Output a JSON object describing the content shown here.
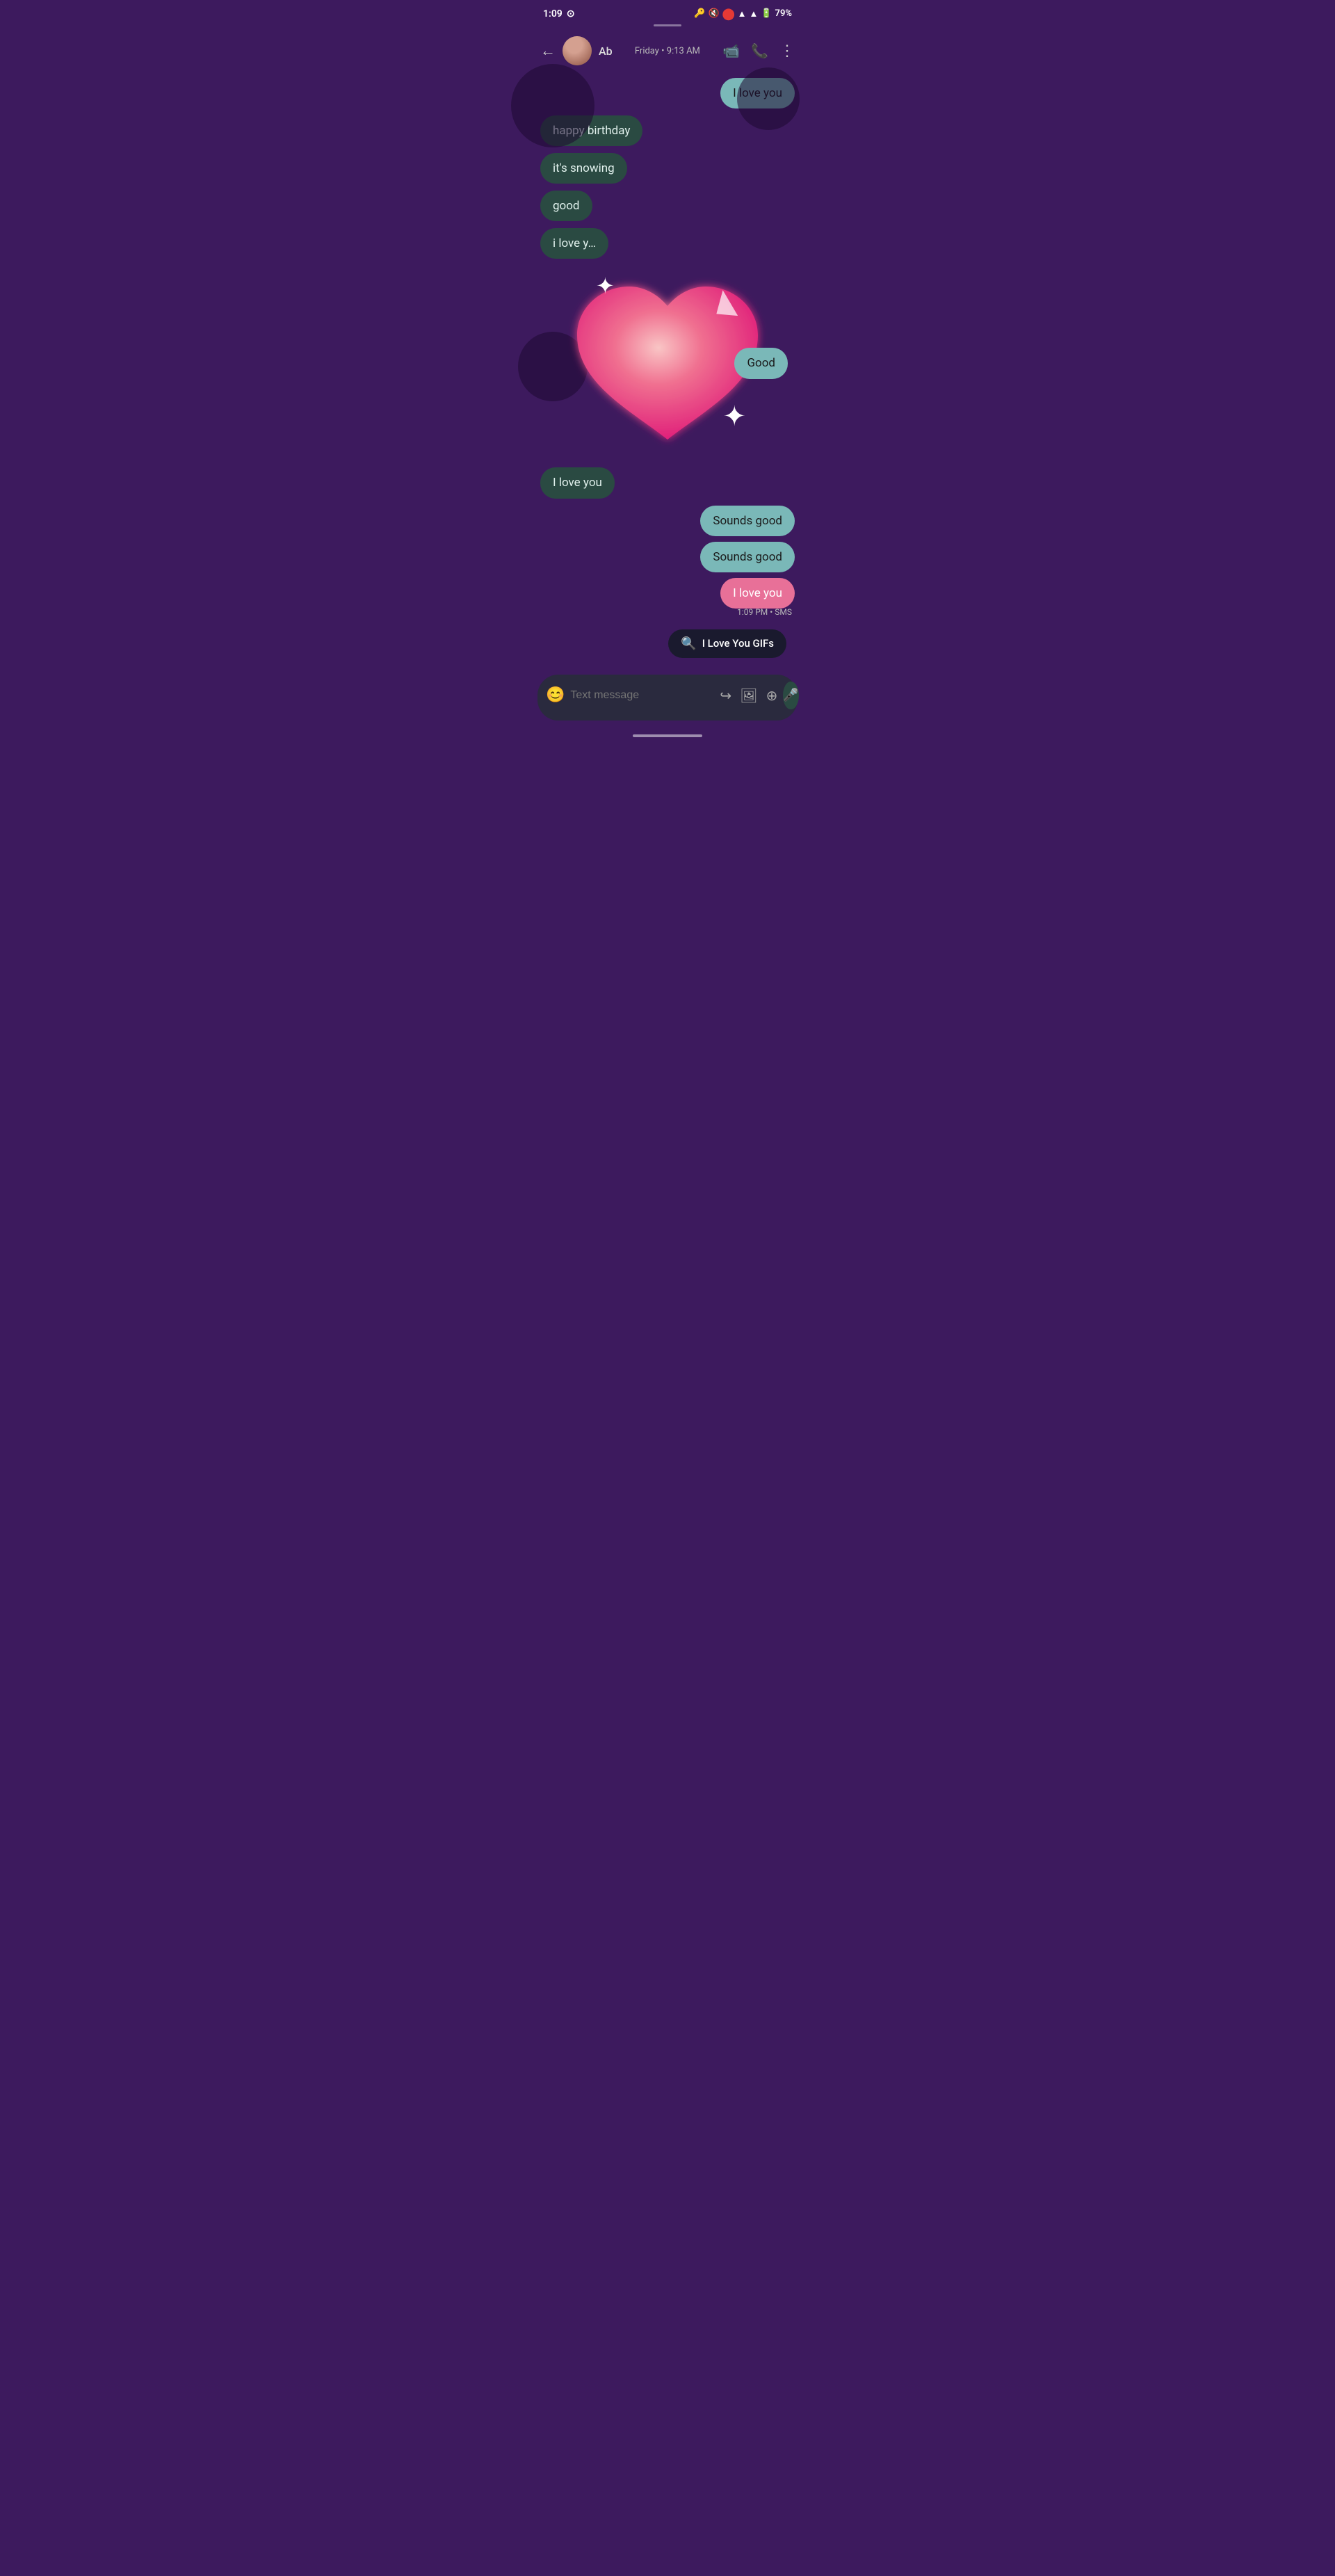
{
  "statusBar": {
    "time": "1:09",
    "battery": "79%",
    "icons": [
      "key-icon",
      "mute-icon",
      "record-icon",
      "signal-icon",
      "wifi-icon",
      "battery-icon"
    ]
  },
  "header": {
    "backLabel": "←",
    "contactInitial": "Ab",
    "timestamp": "Friday • 9:13 AM",
    "videoIcon": "📹",
    "phoneIcon": "📞",
    "moreIcon": "⋮"
  },
  "messages": [
    {
      "id": 1,
      "type": "sent",
      "text": "I love you",
      "side": "right"
    },
    {
      "id": 2,
      "type": "received",
      "text": "happy birthday",
      "side": "left"
    },
    {
      "id": 3,
      "type": "received",
      "text": "it's snowing",
      "side": "left"
    },
    {
      "id": 4,
      "type": "received",
      "text": "good",
      "side": "left"
    },
    {
      "id": 5,
      "type": "received",
      "text": "i love y…",
      "side": "left"
    },
    {
      "id": 6,
      "type": "sent",
      "text": "Good",
      "side": "right"
    },
    {
      "id": 7,
      "type": "received",
      "text": "I love you",
      "side": "left"
    },
    {
      "id": 8,
      "type": "sent",
      "text": "Sounds good",
      "side": "right"
    },
    {
      "id": 9,
      "type": "sent",
      "text": "Sounds good",
      "side": "right"
    },
    {
      "id": 10,
      "type": "sent-pink",
      "text": "I love you",
      "side": "right"
    }
  ],
  "timestamp": "1:09 PM • SMS",
  "gifBar": {
    "icon": "🔍",
    "text": "I Love You GIFs"
  },
  "inputBar": {
    "placeholder": "Text message",
    "emojiIcon": "😊",
    "recycleIcon": "↪",
    "imageIcon": "🖼",
    "addIcon": "+",
    "voiceIcon": "🎤"
  },
  "colors": {
    "bg": "#3d1a5e",
    "receivedBubble": "#2a4a42",
    "sentBubble": "#7ab8b8",
    "pinkBubble": "#e87098",
    "heartGradientStart": "#f4a0b0",
    "heartGradientEnd": "#e8207a"
  }
}
